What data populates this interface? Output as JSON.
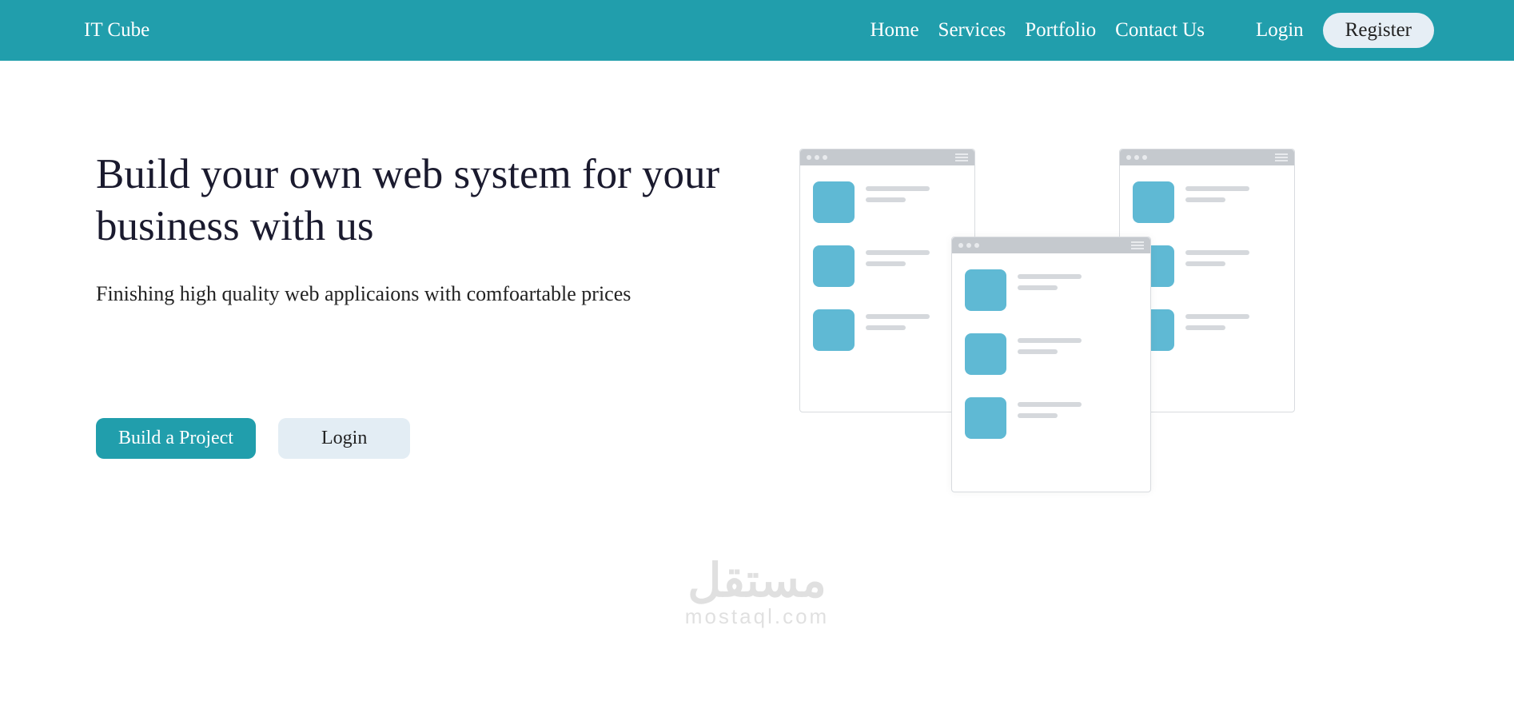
{
  "brand": "IT Cube",
  "nav": {
    "links": [
      "Home",
      "Services",
      "Portfolio",
      "Contact Us"
    ],
    "login": "Login",
    "register": "Register"
  },
  "hero": {
    "title": "Build your own web system for your business with us",
    "subtitle": "Finishing high quality web applicaions with comfoartable prices",
    "primary_btn": "Build a Project",
    "secondary_btn": "Login"
  },
  "watermark": {
    "arabic": "مستقل",
    "latin": "mostaql.com"
  },
  "colors": {
    "primary": "#219eac",
    "light": "#e3edf4",
    "accent": "#5fb9d4"
  }
}
